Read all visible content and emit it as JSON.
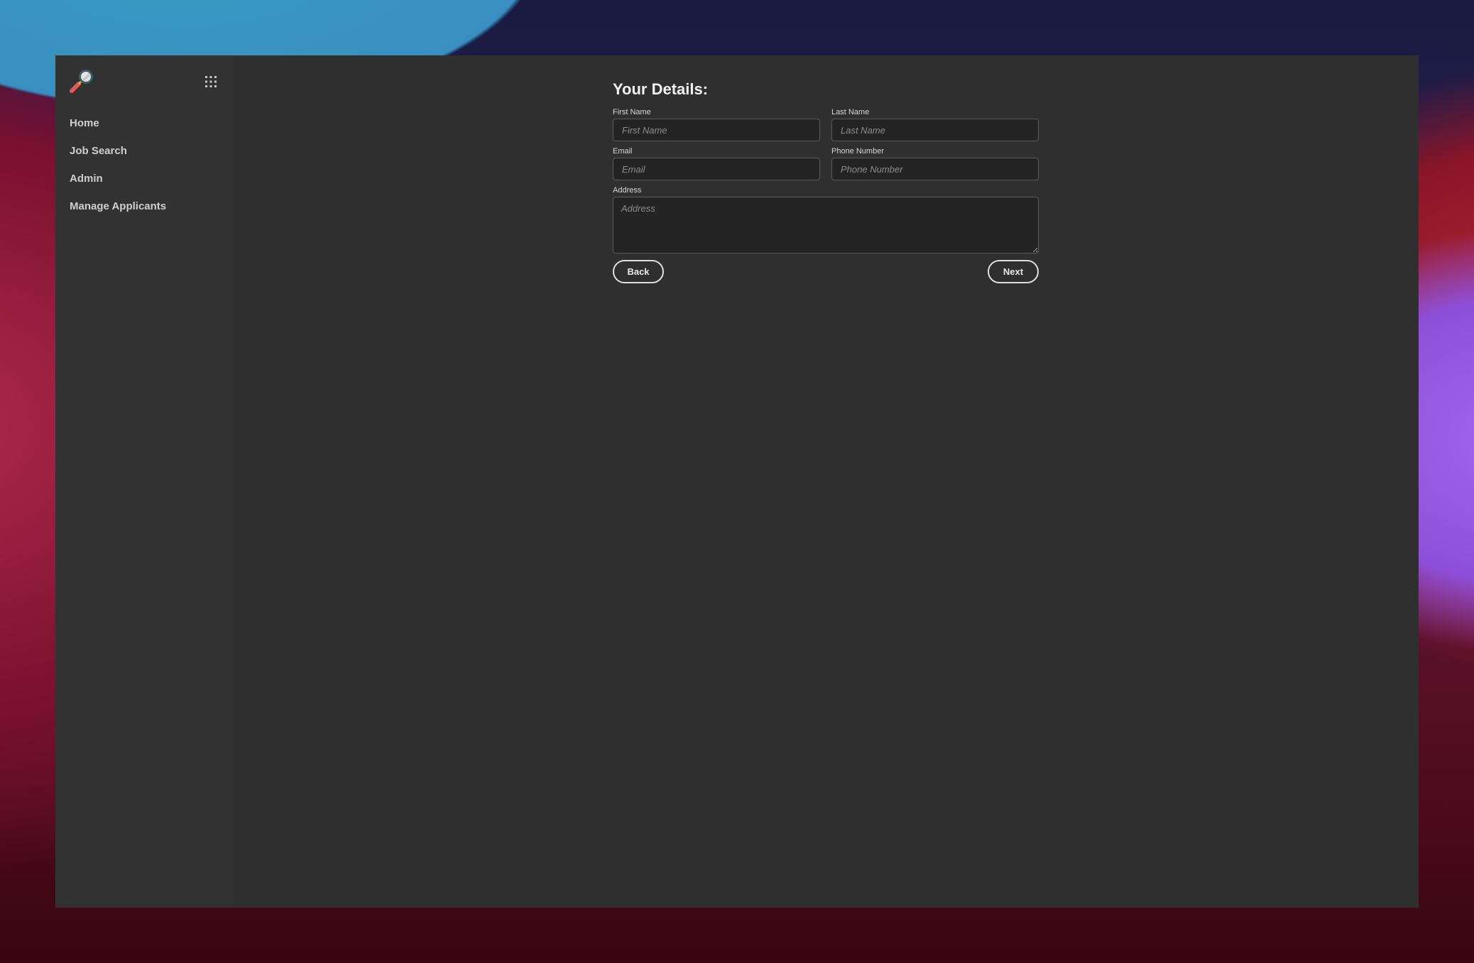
{
  "app": {
    "logo_icon": "magnifying-glass-icon",
    "apps_icon": "grid-icon"
  },
  "sidebar": {
    "items": [
      {
        "label": "Home"
      },
      {
        "label": "Job Search"
      },
      {
        "label": "Admin"
      },
      {
        "label": "Manage Applicants"
      }
    ]
  },
  "form": {
    "title": "Your Details:",
    "first_name": {
      "label": "First Name",
      "placeholder": "First Name",
      "value": ""
    },
    "last_name": {
      "label": "Last Name",
      "placeholder": "Last Name",
      "value": ""
    },
    "email": {
      "label": "Email",
      "placeholder": "Email",
      "value": ""
    },
    "phone": {
      "label": "Phone Number",
      "placeholder": "Phone Number",
      "value": ""
    },
    "address": {
      "label": "Address",
      "placeholder": "Address",
      "value": ""
    },
    "back_label": "Back",
    "next_label": "Next"
  },
  "colors": {
    "window_bg": "#2f2f2f",
    "sidebar_bg": "#323232",
    "input_bg": "#242424",
    "input_border": "#5a5a5a",
    "text": "#cfcfcf"
  }
}
